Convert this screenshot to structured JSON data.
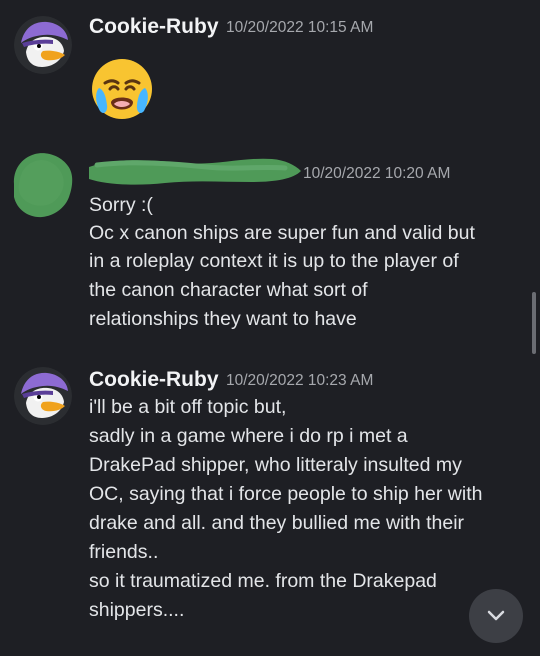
{
  "messages": [
    {
      "author": "Cookie-Ruby",
      "timestamp": "10/20/2022 10:15 AM",
      "content_emoji": "loudly-crying-face"
    },
    {
      "author": "",
      "timestamp": "10/20/2022 10:20 AM",
      "lines": [
        "Sorry :(",
        "Oc x canon ships are super fun and valid but",
        "in a roleplay context it is up to the player of",
        "the canon character what sort of",
        "relationships they want to have"
      ]
    },
    {
      "author": "Cookie-Ruby",
      "timestamp": "10/20/2022 10:23 AM",
      "lines": [
        "i'll be a bit off topic but,",
        " sadly in a game where i do rp i met a",
        "DrakePad shipper, who litteraly insulted my",
        "OC, saying that i force people to ship her with",
        "drake and all. and they bullied me with their",
        "friends..",
        "so it traumatized me. from the Drakepad",
        "shippers...."
      ]
    }
  ],
  "colors": {
    "background": "#1e1f24",
    "redaction_green": "#4f9a58",
    "avatar_purple": "#8d6bd3"
  },
  "icons": {
    "jump_to_present": "chevron-down-icon",
    "avatar": "duck-avatar-icon",
    "emoji": "loudly-crying-face-icon"
  }
}
